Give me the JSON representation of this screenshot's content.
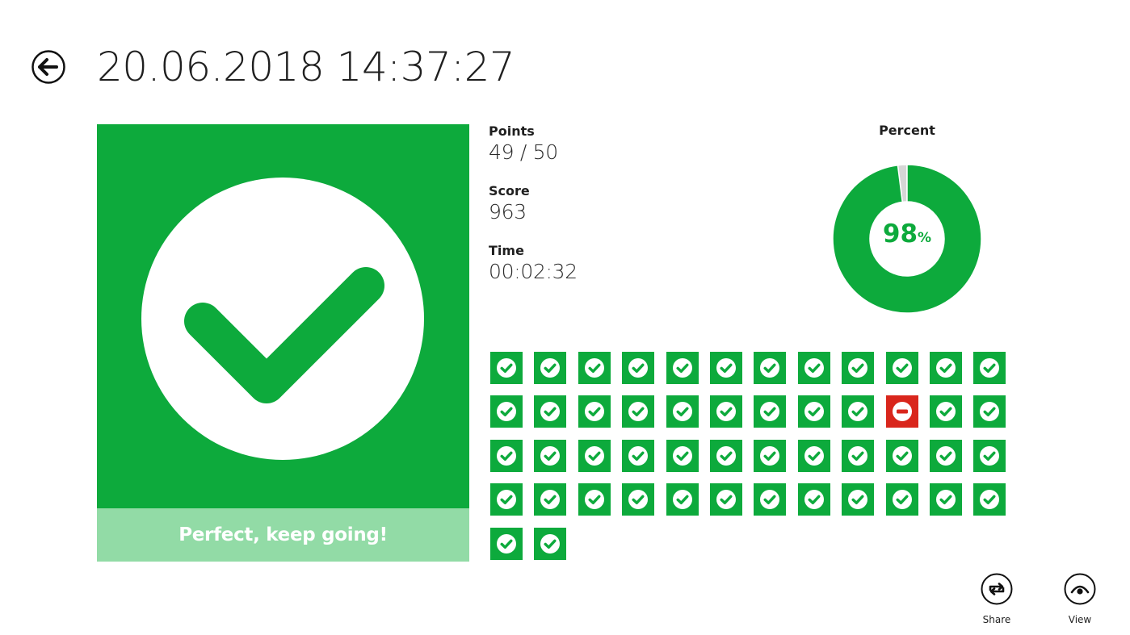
{
  "header": {
    "back_icon": "back-arrow-icon",
    "title": "20.06.2018 14:37:27"
  },
  "result": {
    "icon": "large-check-icon",
    "caption": "Perfect, keep going!",
    "color": "#0daa3c",
    "caption_bg": "#92dba6"
  },
  "stats": {
    "points": {
      "label": "Points",
      "value": "49 / 50"
    },
    "score": {
      "label": "Score",
      "value": "963"
    },
    "time": {
      "label": "Time",
      "value": "00:02:32"
    }
  },
  "percent": {
    "label": "Percent",
    "value": "98",
    "unit": "%",
    "fraction": 0.98,
    "color": "#0daa3c",
    "remainder_color": "#d6d6d6"
  },
  "answers": [
    "correct",
    "correct",
    "correct",
    "correct",
    "correct",
    "correct",
    "correct",
    "correct",
    "correct",
    "correct",
    "correct",
    "correct",
    "correct",
    "correct",
    "correct",
    "correct",
    "correct",
    "correct",
    "correct",
    "correct",
    "correct",
    "wrong",
    "correct",
    "correct",
    "correct",
    "correct",
    "correct",
    "correct",
    "correct",
    "correct",
    "correct",
    "correct",
    "correct",
    "correct",
    "correct",
    "correct",
    "correct",
    "correct",
    "correct",
    "correct",
    "correct",
    "correct",
    "correct",
    "correct",
    "correct",
    "correct",
    "correct",
    "correct",
    "correct",
    "correct"
  ],
  "app_bar": {
    "share": {
      "label": "Share",
      "icon": "share-repeat-icon"
    },
    "view": {
      "label": "View",
      "icon": "view-eye-icon"
    }
  },
  "colors": {
    "correct": "#0daa3c",
    "wrong": "#d9261c"
  }
}
